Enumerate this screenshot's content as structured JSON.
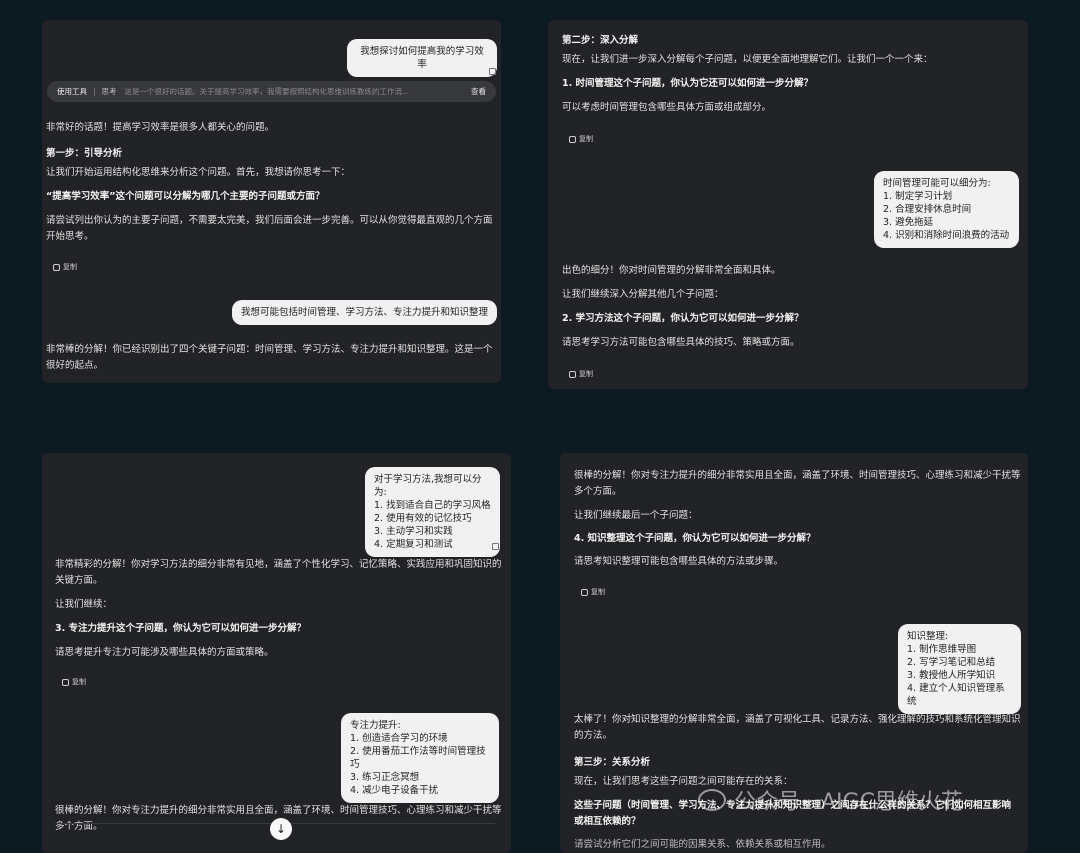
{
  "p1": {
    "user_msg_1": "我想探讨如何提高我的学习效率",
    "toolbar": {
      "tool_label": "使用工具",
      "sep": "|",
      "think_label": "思考",
      "preview": "这是一个很好的话题。关于提高学习效率，我需要按照结构化思维训练教练的工作流...",
      "view_label": "查看"
    },
    "reply_intro": "非常好的话题！提高学习效率是很多人都关心的问题。",
    "step1_title": "第一步：引导分析",
    "step1_line": "让我们开始运用结构化思维来分析这个问题。首先，我想请你思考一下：",
    "question_bold": "“提高学习效率”这个问题可以分解为哪几个主要的子问题或方面？",
    "hint_line1": "请尝试列出你认为的主要子问题，不需要太完美，我们后面会进一步完善。可以从你觉得最直观的几个方面",
    "hint_line2": "开始思考。",
    "copy_label": "复制",
    "user_msg_2": "我想可能包括时间管理、学习方法、专注力提升和知识整理",
    "reply2_line1": "非常棒的分解！你已经识别出了四个关键子问题：时间管理、学习方法、专注力提升和知识整理。这是一个",
    "reply2_line2": "很好的起点。"
  },
  "p2": {
    "step2_title": "第二步：深入分解",
    "step2_line": "现在，让我们进一步深入分解每个子问题，以便更全面地理解它们。让我们一个一个来：",
    "q1_bold": "1. 时间管理这个子问题，你认为它还可以如何进一步分解？",
    "q1_hint": "可以考虑时间管理包含哪些具体方面或组成部分。",
    "copy_label": "复制",
    "user_bubble": "时间管理可能可以细分为:\n1. 制定学习计划\n2. 合理安排休息时间\n3. 避免拖延\n4. 识别和消除时间浪费的活动",
    "reply_praise": "出色的细分！你对时间管理的分解非常全面和具体。",
    "continue_line": "让我们继续深入分解其他几个子问题：",
    "q2_bold": "2. 学习方法这个子问题，你认为它可以如何进一步分解？",
    "q2_hint": "请思考学习方法可能包含哪些具体的技巧、策略或方面。",
    "copy_label2": "复制"
  },
  "p3": {
    "user_bubble_1": "对于学习方法,我想可以分为:\n1. 找到适合自己的学习风格\n2. 使用有效的记忆技巧\n3. 主动学习和实践\n4. 定期复习和测试",
    "reply_line1": "非常精彩的分解！你对学习方法的细分非常有见地，涵盖了个性化学习、记忆策略、实践应用和巩固知识的",
    "reply_line2": "关键方面。",
    "continue_line": "让我们继续：",
    "q3_bold": "3. 专注力提升这个子问题，你认为它可以如何进一步分解？",
    "q3_hint": "请思考提升专注力可能涉及哪些具体的方面或策略。",
    "copy_label": "复制",
    "user_bubble_2": "专注力提升:\n1. 创造适合学习的环境\n2. 使用番茄工作法等时间管理技巧\n3. 练习正念冥想\n4. 减少电子设备干扰",
    "reply2_line1": "很棒的分解！你对专注力提升的细分非常实用且全面，涵盖了环境、时间管理技巧、心理练习和减少干扰等",
    "reply2_line2": "多个方面。",
    "scroll_icon": "arrow-down-icon"
  },
  "p4": {
    "top_line1": "很棒的分解！你对专注力提升的细分非常实用且全面，涵盖了环境、时间管理技巧、心理练习和减少干扰等",
    "top_line2": "多个方面。",
    "continue_line": "让我们继续最后一个子问题：",
    "q4_bold": "4. 知识整理这个子问题，你认为它可以如何进一步分解？",
    "q4_hint": "请思考知识整理可能包含哪些具体的方法或步骤。",
    "copy_label": "复制",
    "user_bubble": "知识整理:\n1. 制作思维导图\n2. 写学习笔记和总结\n3. 教授他人所学知识\n4. 建立个人知识管理系统",
    "reply_line1": "太棒了！你对知识整理的分解非常全面，涵盖了可视化工具、记录方法、强化理解的技巧和系统化管理知识",
    "reply_line2": "的方法。",
    "step3_title": "第三步：关系分析",
    "step3_line": "现在，让我们思考这些子问题之间可能存在的关系：",
    "q5_bold_1": "这些子问题（时间管理、学习方法、专注力提升和知识整理）之间存在什么样的关系？它们如何相互影响",
    "q5_bold_2": "或相互依赖的？",
    "cutoff_line": "请尝试分析它们之间可能的因果关系、依赖关系或相互作用。"
  },
  "watermark": {
    "text": "公众号 · AIGC思维火花",
    "icon": "wechat-icon"
  }
}
